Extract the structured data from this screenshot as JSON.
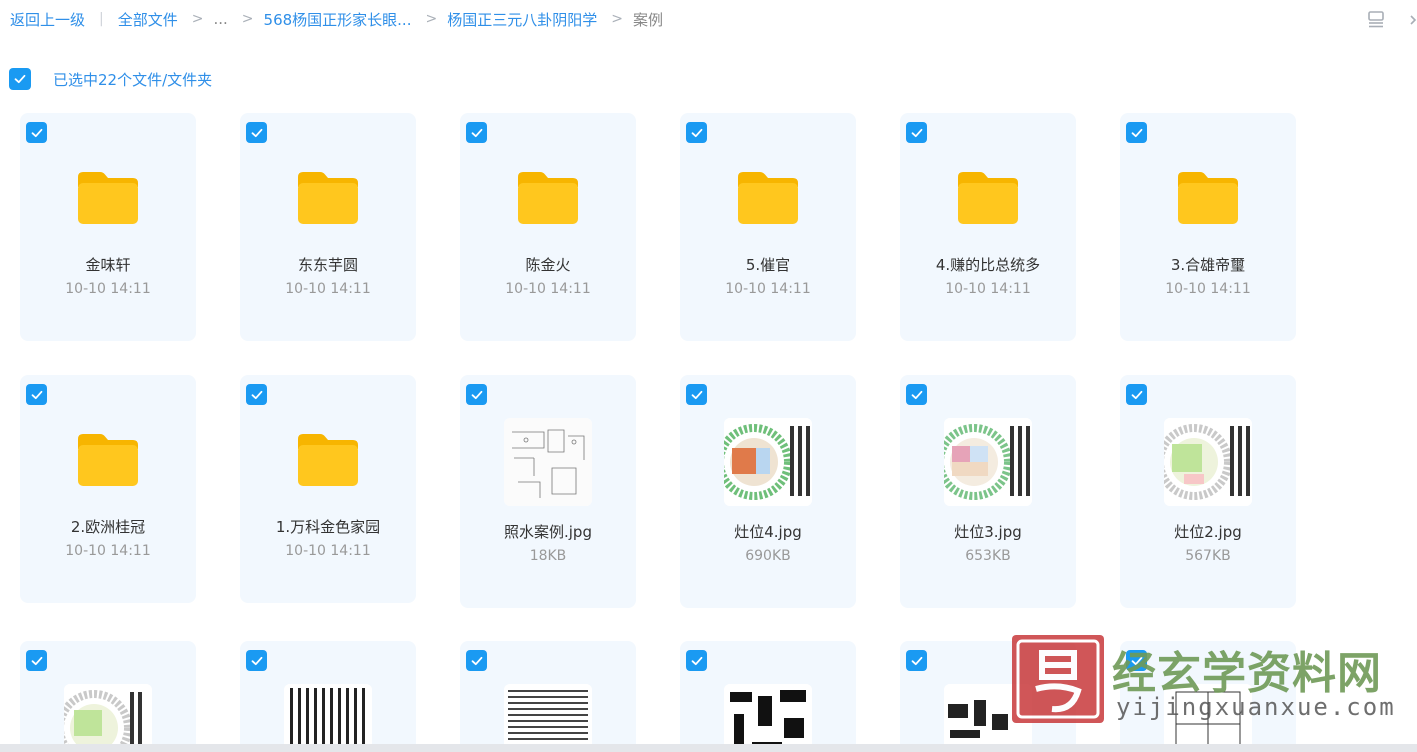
{
  "breadcrumb": {
    "back": "返回上一级",
    "all_files": "全部文件",
    "ellipsis": "...",
    "path1": "568杨国正形家长眼...",
    "path2": "杨国正三元八卦阴阳学",
    "current": "案例",
    "separator": ">",
    "divider": "|"
  },
  "selection": {
    "text": "已选中22个文件/文件夹"
  },
  "watermark": {
    "title": "经玄学资料网",
    "url": "yijingxuanxue.com"
  },
  "colors": {
    "accent": "#1a9af2",
    "link": "#2f8fe8",
    "card_bg": "#f2f8fe",
    "folder": "#ffc71e"
  },
  "row1": [
    {
      "name": "金味轩",
      "meta": "10-10 14:11"
    },
    {
      "name": "东东芋圆",
      "meta": "10-10 14:11"
    },
    {
      "name": "陈金火",
      "meta": "10-10 14:11"
    },
    {
      "name": "5.催官",
      "meta": "10-10 14:11"
    },
    {
      "name": "4.赚的比总统多",
      "meta": "10-10 14:11"
    },
    {
      "name": "3.合雄帝璽",
      "meta": "10-10 14:11"
    }
  ],
  "row2": [
    {
      "name": "2.欧洲桂冠",
      "meta": "10-10 14:11"
    },
    {
      "name": "1.万科金色家园",
      "meta": "10-10 14:11"
    },
    {
      "name": "照水案例.jpg",
      "meta": "18KB"
    },
    {
      "name": "灶位4.jpg",
      "meta": "690KB"
    },
    {
      "name": "灶位3.jpg",
      "meta": "653KB"
    },
    {
      "name": "灶位2.jpg",
      "meta": "567KB"
    }
  ]
}
